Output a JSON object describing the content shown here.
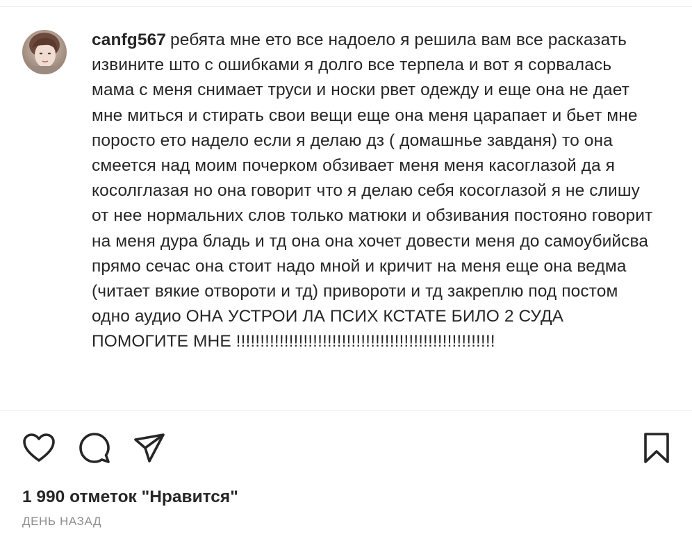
{
  "post": {
    "username": "canfg567",
    "caption_text": "ребята мне ето все надоело я решила вам все расказать извините што с ошибками я долго все терпела и вот я сорвалась мама с меня снимает труси и носки рвет одежду и еще она не дает мне миться и стирать свои вещи еще она меня царапает и бьет мне поросто ето надело если я делаю дз ( домашнье завданя) то она смеется над моим почерком обзивает меня меня касоглазой да я косолглазая но она говорит что я делаю себя косоглазой я не слишу от нее нормальних слов только матюки и обзивания постояно говорит на меня дура бладь и тд она она хочет довести меня до самоубийсва прямо сечас она стоит надо мной и кричит на меня еще она ведма (читает вякие отвороти и тд) привороти и тд закреплю под постом одно аудио ОНА УСТРОИ ЛА ПСИХ КСТАТЕ БИЛО 2 СУДА ПОМОГИТЕ МНЕ !!!!!!!!!!!!!!!!!!!!!!!!!!!!!!!!!!!!!!!!!!!!!!!!!!!!!!",
    "avatar_icon": "user-avatar"
  },
  "actions": {
    "like_icon": "heart-icon",
    "comment_icon": "comment-icon",
    "share_icon": "paper-plane-icon",
    "save_icon": "bookmark-icon"
  },
  "stats": {
    "likes_text": "1 990 отметок \"Нравится\"",
    "time_text": "ДЕНЬ НАЗАД"
  }
}
